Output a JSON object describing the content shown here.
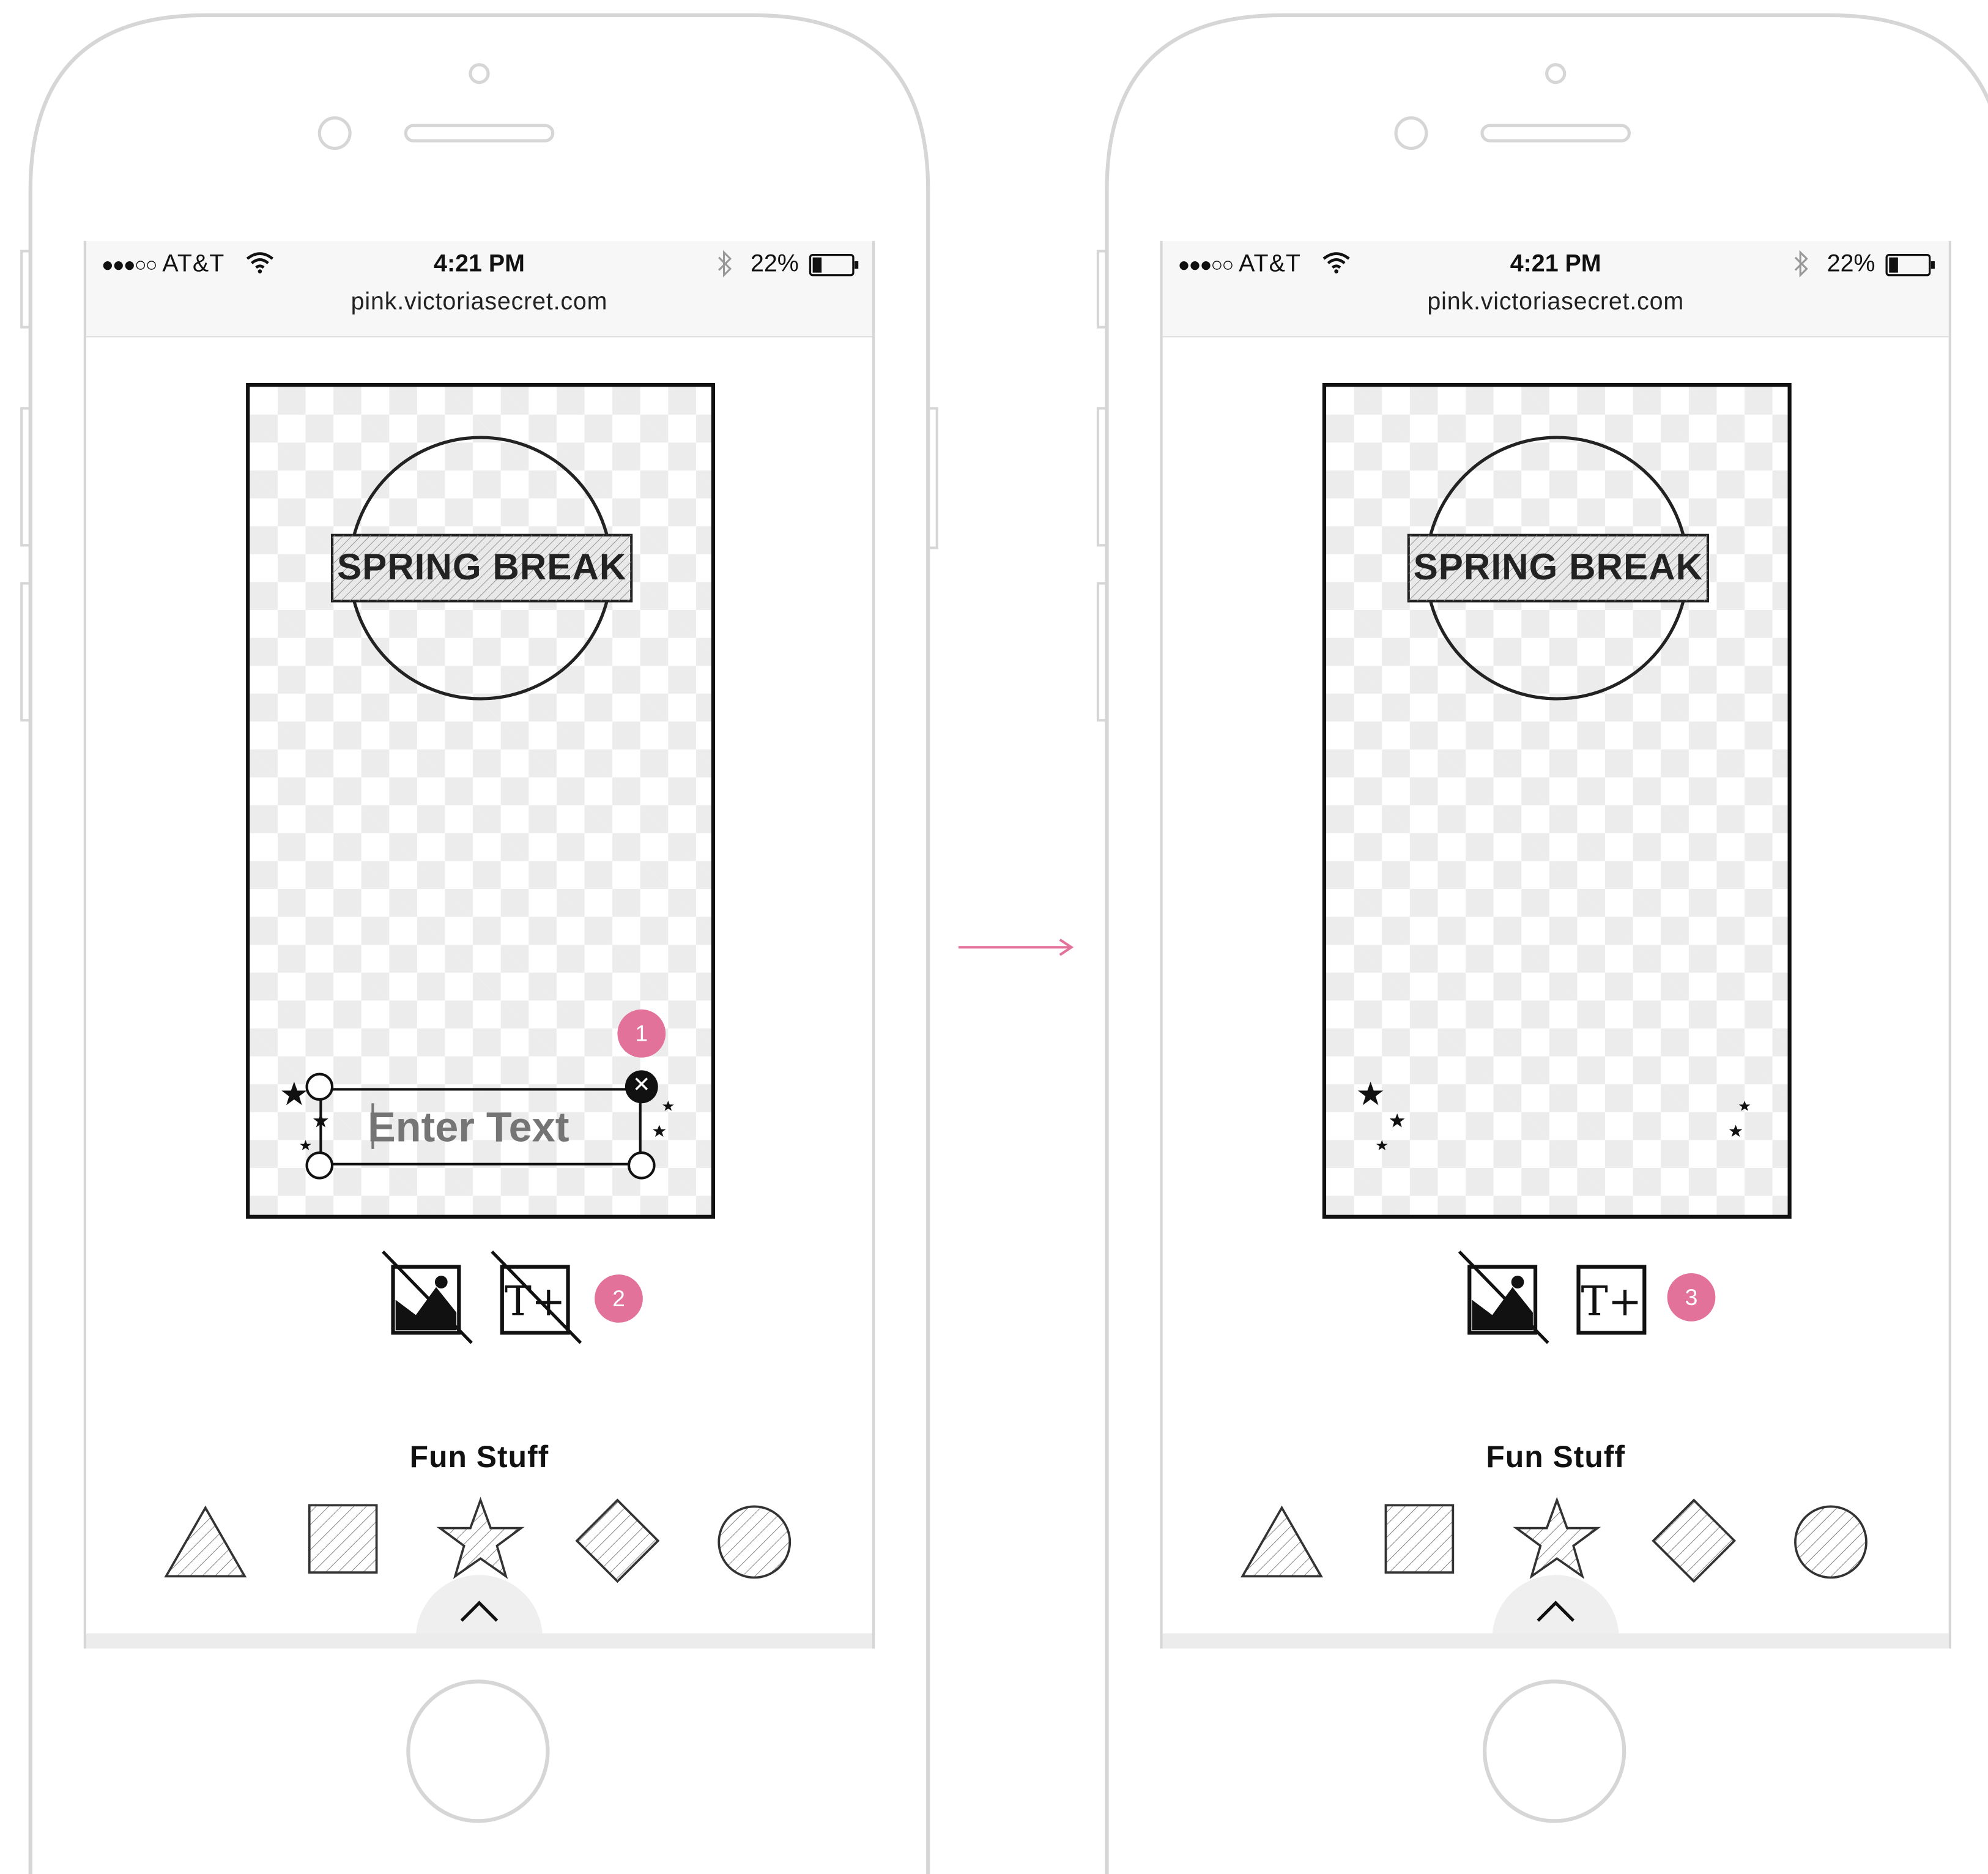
{
  "colors": {
    "accent_pink": "#e2729a",
    "frame_gray": "#d6d6d6",
    "ink": "#111111",
    "checker": "#ececec"
  },
  "status_bar": {
    "signal_dots": "●●●○○",
    "carrier": "AT&T",
    "time": "4:21 PM",
    "battery_percent": "22%",
    "url": "pink.victoriasecret.com",
    "icons": [
      "wifi-icon",
      "bluetooth-icon",
      "battery-icon"
    ]
  },
  "design_canvas": {
    "badge_text": "SPRING BREAK"
  },
  "left_screen": {
    "text_box": {
      "placeholder": "Enter Text",
      "close_symbol": "✕"
    },
    "badges": [
      "1",
      "2"
    ],
    "tools": [
      {
        "name": "add-image",
        "icon": "image-icon",
        "disabled": true
      },
      {
        "name": "add-text",
        "icon": "text-plus-icon",
        "label": "T+",
        "disabled": true
      }
    ]
  },
  "right_screen": {
    "badges": [
      "3"
    ],
    "tools": [
      {
        "name": "add-image",
        "icon": "image-icon",
        "disabled": true
      },
      {
        "name": "add-text",
        "icon": "text-plus-icon",
        "label": "T+",
        "disabled": false
      }
    ]
  },
  "fun_stuff": {
    "title": "Fun Stuff",
    "shapes": [
      "triangle-icon",
      "square-icon",
      "star-icon",
      "diamond-icon",
      "circle-icon"
    ]
  },
  "drawer_toggle_icon": "chevron-up-icon"
}
